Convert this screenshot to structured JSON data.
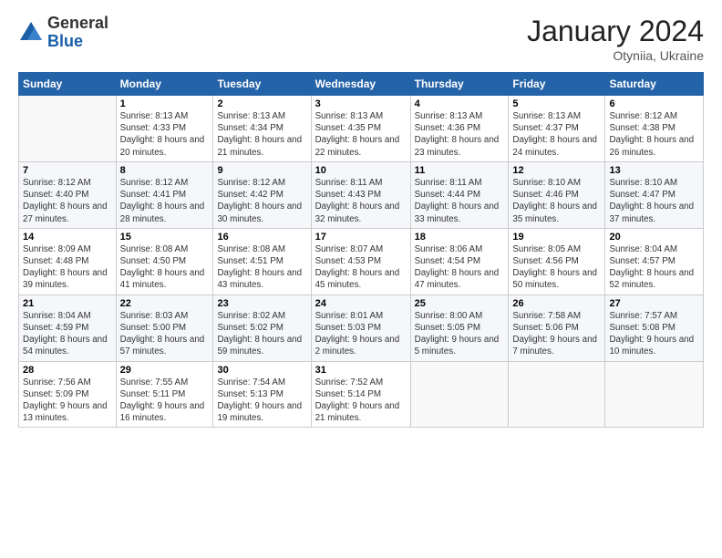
{
  "logo": {
    "general": "General",
    "blue": "Blue"
  },
  "header": {
    "month": "January 2024",
    "location": "Otyniia, Ukraine"
  },
  "days_of_week": [
    "Sunday",
    "Monday",
    "Tuesday",
    "Wednesday",
    "Thursday",
    "Friday",
    "Saturday"
  ],
  "weeks": [
    [
      {
        "day": "",
        "sunrise": "",
        "sunset": "",
        "daylight": ""
      },
      {
        "day": "1",
        "sunrise": "Sunrise: 8:13 AM",
        "sunset": "Sunset: 4:33 PM",
        "daylight": "Daylight: 8 hours and 20 minutes."
      },
      {
        "day": "2",
        "sunrise": "Sunrise: 8:13 AM",
        "sunset": "Sunset: 4:34 PM",
        "daylight": "Daylight: 8 hours and 21 minutes."
      },
      {
        "day": "3",
        "sunrise": "Sunrise: 8:13 AM",
        "sunset": "Sunset: 4:35 PM",
        "daylight": "Daylight: 8 hours and 22 minutes."
      },
      {
        "day": "4",
        "sunrise": "Sunrise: 8:13 AM",
        "sunset": "Sunset: 4:36 PM",
        "daylight": "Daylight: 8 hours and 23 minutes."
      },
      {
        "day": "5",
        "sunrise": "Sunrise: 8:13 AM",
        "sunset": "Sunset: 4:37 PM",
        "daylight": "Daylight: 8 hours and 24 minutes."
      },
      {
        "day": "6",
        "sunrise": "Sunrise: 8:12 AM",
        "sunset": "Sunset: 4:38 PM",
        "daylight": "Daylight: 8 hours and 26 minutes."
      }
    ],
    [
      {
        "day": "7",
        "sunrise": "Sunrise: 8:12 AM",
        "sunset": "Sunset: 4:40 PM",
        "daylight": "Daylight: 8 hours and 27 minutes."
      },
      {
        "day": "8",
        "sunrise": "Sunrise: 8:12 AM",
        "sunset": "Sunset: 4:41 PM",
        "daylight": "Daylight: 8 hours and 28 minutes."
      },
      {
        "day": "9",
        "sunrise": "Sunrise: 8:12 AM",
        "sunset": "Sunset: 4:42 PM",
        "daylight": "Daylight: 8 hours and 30 minutes."
      },
      {
        "day": "10",
        "sunrise": "Sunrise: 8:11 AM",
        "sunset": "Sunset: 4:43 PM",
        "daylight": "Daylight: 8 hours and 32 minutes."
      },
      {
        "day": "11",
        "sunrise": "Sunrise: 8:11 AM",
        "sunset": "Sunset: 4:44 PM",
        "daylight": "Daylight: 8 hours and 33 minutes."
      },
      {
        "day": "12",
        "sunrise": "Sunrise: 8:10 AM",
        "sunset": "Sunset: 4:46 PM",
        "daylight": "Daylight: 8 hours and 35 minutes."
      },
      {
        "day": "13",
        "sunrise": "Sunrise: 8:10 AM",
        "sunset": "Sunset: 4:47 PM",
        "daylight": "Daylight: 8 hours and 37 minutes."
      }
    ],
    [
      {
        "day": "14",
        "sunrise": "Sunrise: 8:09 AM",
        "sunset": "Sunset: 4:48 PM",
        "daylight": "Daylight: 8 hours and 39 minutes."
      },
      {
        "day": "15",
        "sunrise": "Sunrise: 8:08 AM",
        "sunset": "Sunset: 4:50 PM",
        "daylight": "Daylight: 8 hours and 41 minutes."
      },
      {
        "day": "16",
        "sunrise": "Sunrise: 8:08 AM",
        "sunset": "Sunset: 4:51 PM",
        "daylight": "Daylight: 8 hours and 43 minutes."
      },
      {
        "day": "17",
        "sunrise": "Sunrise: 8:07 AM",
        "sunset": "Sunset: 4:53 PM",
        "daylight": "Daylight: 8 hours and 45 minutes."
      },
      {
        "day": "18",
        "sunrise": "Sunrise: 8:06 AM",
        "sunset": "Sunset: 4:54 PM",
        "daylight": "Daylight: 8 hours and 47 minutes."
      },
      {
        "day": "19",
        "sunrise": "Sunrise: 8:05 AM",
        "sunset": "Sunset: 4:56 PM",
        "daylight": "Daylight: 8 hours and 50 minutes."
      },
      {
        "day": "20",
        "sunrise": "Sunrise: 8:04 AM",
        "sunset": "Sunset: 4:57 PM",
        "daylight": "Daylight: 8 hours and 52 minutes."
      }
    ],
    [
      {
        "day": "21",
        "sunrise": "Sunrise: 8:04 AM",
        "sunset": "Sunset: 4:59 PM",
        "daylight": "Daylight: 8 hours and 54 minutes."
      },
      {
        "day": "22",
        "sunrise": "Sunrise: 8:03 AM",
        "sunset": "Sunset: 5:00 PM",
        "daylight": "Daylight: 8 hours and 57 minutes."
      },
      {
        "day": "23",
        "sunrise": "Sunrise: 8:02 AM",
        "sunset": "Sunset: 5:02 PM",
        "daylight": "Daylight: 8 hours and 59 minutes."
      },
      {
        "day": "24",
        "sunrise": "Sunrise: 8:01 AM",
        "sunset": "Sunset: 5:03 PM",
        "daylight": "Daylight: 9 hours and 2 minutes."
      },
      {
        "day": "25",
        "sunrise": "Sunrise: 8:00 AM",
        "sunset": "Sunset: 5:05 PM",
        "daylight": "Daylight: 9 hours and 5 minutes."
      },
      {
        "day": "26",
        "sunrise": "Sunrise: 7:58 AM",
        "sunset": "Sunset: 5:06 PM",
        "daylight": "Daylight: 9 hours and 7 minutes."
      },
      {
        "day": "27",
        "sunrise": "Sunrise: 7:57 AM",
        "sunset": "Sunset: 5:08 PM",
        "daylight": "Daylight: 9 hours and 10 minutes."
      }
    ],
    [
      {
        "day": "28",
        "sunrise": "Sunrise: 7:56 AM",
        "sunset": "Sunset: 5:09 PM",
        "daylight": "Daylight: 9 hours and 13 minutes."
      },
      {
        "day": "29",
        "sunrise": "Sunrise: 7:55 AM",
        "sunset": "Sunset: 5:11 PM",
        "daylight": "Daylight: 9 hours and 16 minutes."
      },
      {
        "day": "30",
        "sunrise": "Sunrise: 7:54 AM",
        "sunset": "Sunset: 5:13 PM",
        "daylight": "Daylight: 9 hours and 19 minutes."
      },
      {
        "day": "31",
        "sunrise": "Sunrise: 7:52 AM",
        "sunset": "Sunset: 5:14 PM",
        "daylight": "Daylight: 9 hours and 21 minutes."
      },
      {
        "day": "",
        "sunrise": "",
        "sunset": "",
        "daylight": ""
      },
      {
        "day": "",
        "sunrise": "",
        "sunset": "",
        "daylight": ""
      },
      {
        "day": "",
        "sunrise": "",
        "sunset": "",
        "daylight": ""
      }
    ]
  ]
}
